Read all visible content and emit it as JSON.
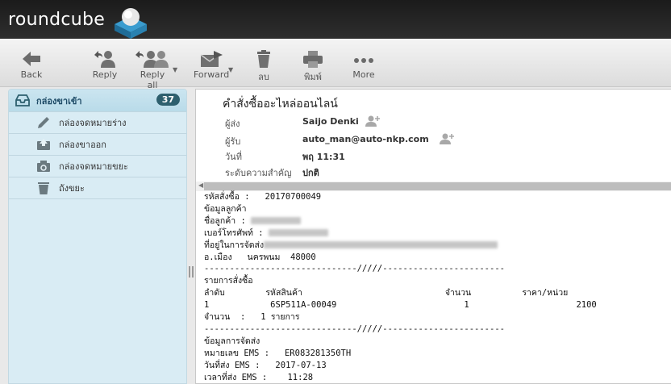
{
  "app": {
    "logo_text": "roundcube"
  },
  "toolbar": {
    "back": "Back",
    "reply": "Reply",
    "reply_all": "Reply all",
    "forward": "Forward",
    "delete": "ลบ",
    "print": "พิมพ์",
    "more": "More"
  },
  "sidebar": {
    "folders": [
      {
        "label": "กล่องขาเข้า",
        "icon": "inbox-icon",
        "count": "37"
      },
      {
        "label": "กล่องจดหมายร่าง",
        "icon": "pencil-icon"
      },
      {
        "label": "กล่องขาออก",
        "icon": "outbox-icon"
      },
      {
        "label": "กล่องจดหมายขยะ",
        "icon": "junk-icon"
      },
      {
        "label": "ถังขยะ",
        "icon": "trash-icon"
      }
    ]
  },
  "message": {
    "subject": "คำสั่งซื้ออะไหล่ออนไลน์",
    "headers": [
      {
        "label": "ผู้ส่ง",
        "value": "Saijo Denki"
      },
      {
        "label": "ผู้รับ",
        "value": "auto_man@auto-nkp.com"
      },
      {
        "label": "วันที่",
        "value": "พฤ 11:31"
      },
      {
        "label": "ระดับความสำคัญ",
        "value": "ปกติ"
      }
    ],
    "body": {
      "order_line": "รหัสสั่งซื้อ :   20170700049",
      "customer_heading": "ข้อมูลลูกค้า",
      "customer_name_label": "ชื่อลูกค้า : ",
      "phone_label": "เบอร์โทรศัพท์ : ",
      "address_label": "ที่อยู่ในการจัดส่ง",
      "district_line": "อ.เมือง   นครพนม  48000",
      "divider": "------------------------------/////------------------------",
      "items_heading": "รายการสั่งซื้อ",
      "items_header": "ลำดับ        รหัสสินค้า                            จำนวน          ราคา/หน่วย",
      "item_row": "1            6SP511A-00049                         1                     2100",
      "items_total": "จำนวน  :   1 รายการ",
      "shipping_heading": "ข้อมูลการจัดส่ง",
      "tracking_line": "หมายเลข EMS :   ER083281350TH",
      "ship_date_line": "วันที่ส่ง EMS :   2017-07-13",
      "ship_time_line": "เวลาที่ส่ง EMS :    11:28"
    }
  }
}
